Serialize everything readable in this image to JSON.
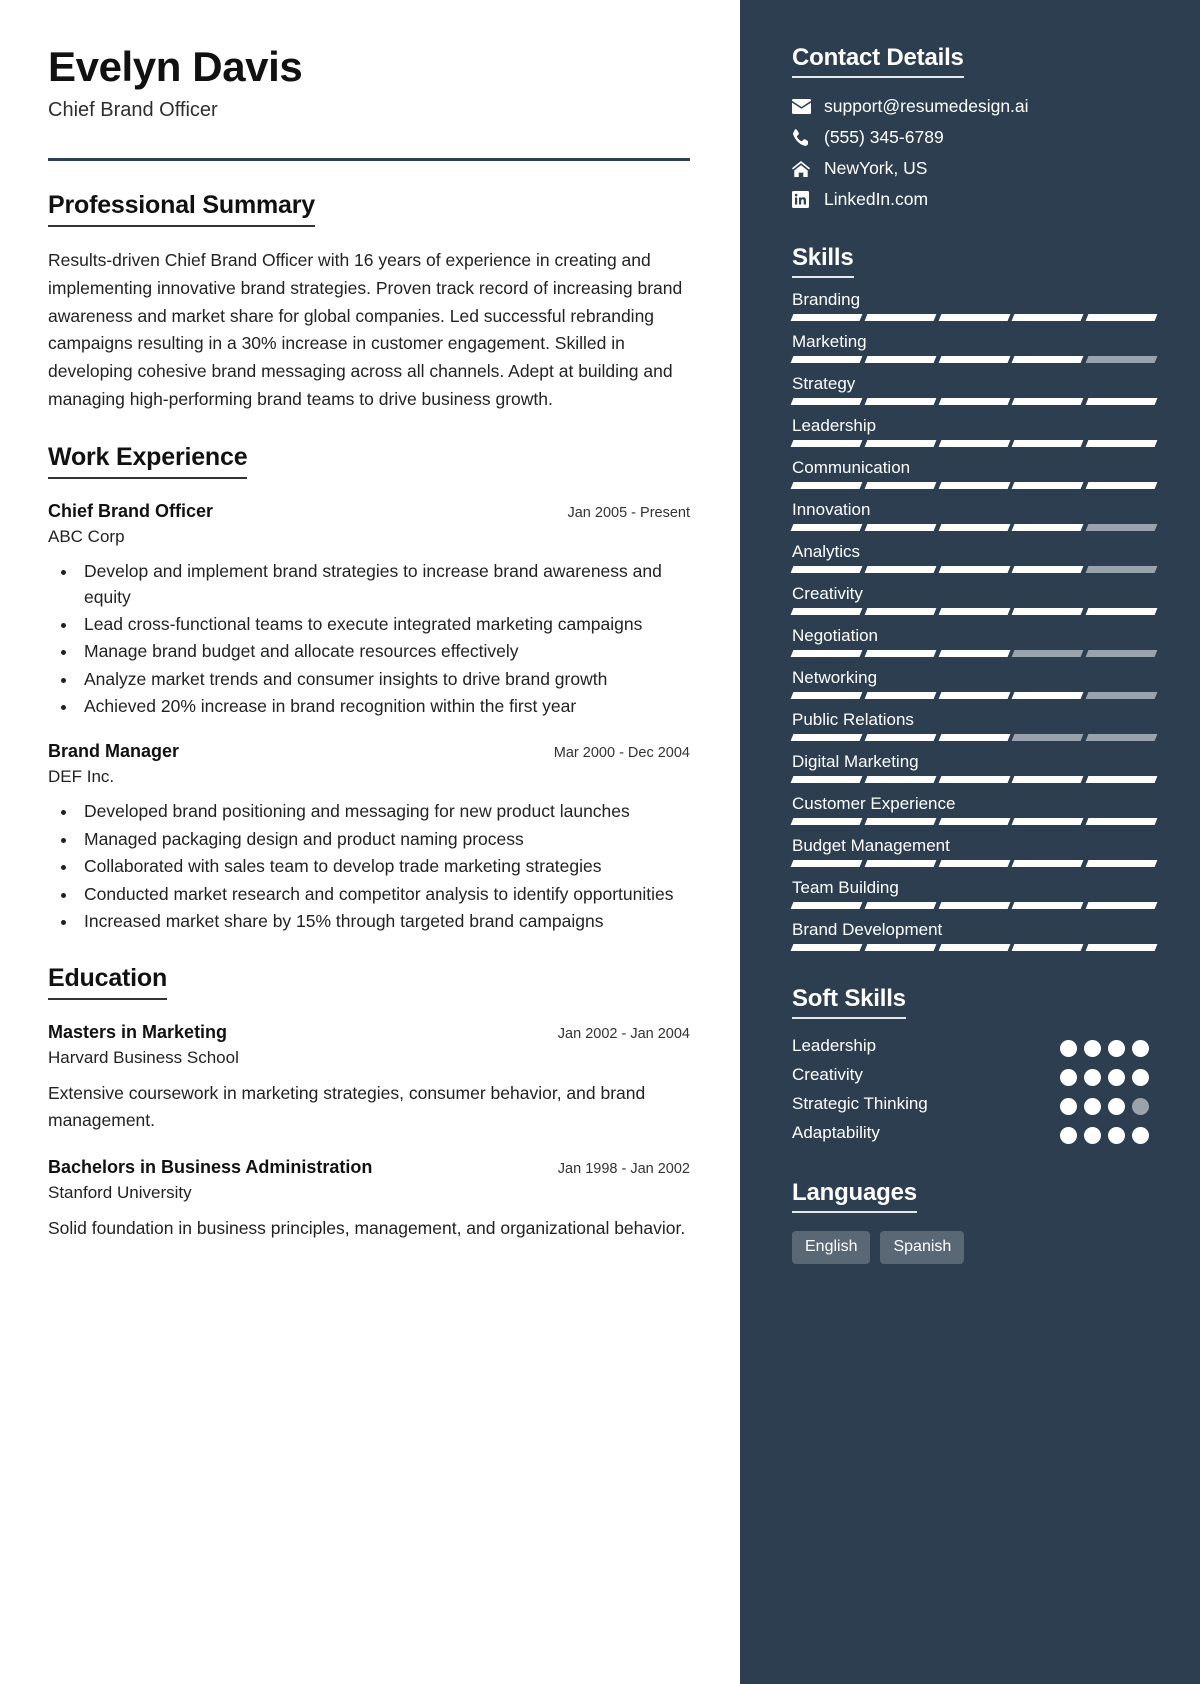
{
  "theme": {
    "sidebar_bg": "#2c3e50",
    "page_bg": "#ffffff",
    "accent_rule": "#2d3e50",
    "skill_on": "#ffffff",
    "skill_off": "#9aa3ab",
    "chip_bg": "#5a6875"
  },
  "header": {
    "name": "Evelyn Davis",
    "job_title": "Chief Brand Officer"
  },
  "summary": {
    "heading": "Professional Summary",
    "text": "Results-driven Chief Brand Officer with 16 years of experience in creating and implementing innovative brand strategies. Proven track record of increasing brand awareness and market share for global companies. Led successful rebranding campaigns resulting in a 30% increase in customer engagement. Skilled in developing cohesive brand messaging across all channels. Adept at building and managing high-performing brand teams to drive business growth."
  },
  "work": {
    "heading": "Work Experience",
    "entries": [
      {
        "role": "Chief Brand Officer",
        "org": "ABC Corp",
        "date": "Jan 2005 - Present",
        "bullets": [
          "Develop and implement brand strategies to increase brand awareness and equity",
          "Lead cross-functional teams to execute integrated marketing campaigns",
          "Manage brand budget and allocate resources effectively",
          "Analyze market trends and consumer insights to drive brand growth",
          "Achieved 20% increase in brand recognition within the first year"
        ]
      },
      {
        "role": "Brand Manager",
        "org": "DEF Inc.",
        "date": "Mar 2000 - Dec 2004",
        "bullets": [
          "Developed brand positioning and messaging for new product launches",
          "Managed packaging design and product naming process",
          "Collaborated with sales team to develop trade marketing strategies",
          "Conducted market research and competitor analysis to identify opportunities",
          "Increased market share by 15% through targeted brand campaigns"
        ]
      }
    ]
  },
  "education": {
    "heading": "Education",
    "entries": [
      {
        "degree": "Masters in Marketing",
        "school": "Harvard Business School",
        "date": "Jan 2002 - Jan 2004",
        "desc": "Extensive coursework in marketing strategies, consumer behavior, and brand management."
      },
      {
        "degree": "Bachelors in Business Administration",
        "school": "Stanford University",
        "date": "Jan 1998 - Jan 2002",
        "desc": "Solid foundation in business principles, management, and organizational behavior."
      }
    ]
  },
  "contact": {
    "heading": "Contact Details",
    "items": [
      {
        "icon": "envelope-icon",
        "value": "support@resumedesign.ai"
      },
      {
        "icon": "phone-icon",
        "value": "(555) 345-6789"
      },
      {
        "icon": "home-icon",
        "value": "NewYork, US"
      },
      {
        "icon": "linkedin-icon",
        "value": "LinkedIn.com"
      }
    ]
  },
  "skills": {
    "heading": "Skills",
    "segments_total": 5,
    "items": [
      {
        "name": "Branding",
        "filled": 5
      },
      {
        "name": "Marketing",
        "filled": 4
      },
      {
        "name": "Strategy",
        "filled": 5
      },
      {
        "name": "Leadership",
        "filled": 5
      },
      {
        "name": "Communication",
        "filled": 5
      },
      {
        "name": "Innovation",
        "filled": 4
      },
      {
        "name": "Analytics",
        "filled": 4
      },
      {
        "name": "Creativity",
        "filled": 5
      },
      {
        "name": "Negotiation",
        "filled": 3
      },
      {
        "name": "Networking",
        "filled": 4
      },
      {
        "name": "Public Relations",
        "filled": 3
      },
      {
        "name": "Digital Marketing",
        "filled": 5
      },
      {
        "name": "Customer Experience",
        "filled": 5
      },
      {
        "name": "Budget Management",
        "filled": 5
      },
      {
        "name": "Team Building",
        "filled": 5
      },
      {
        "name": "Brand Development",
        "filled": 5
      }
    ]
  },
  "soft_skills": {
    "heading": "Soft Skills",
    "dots_total": 4,
    "items": [
      {
        "name": "Leadership",
        "filled": 4
      },
      {
        "name": "Creativity",
        "filled": 4
      },
      {
        "name": "Strategic Thinking",
        "filled": 3
      },
      {
        "name": "Adaptability",
        "filled": 4
      }
    ]
  },
  "languages": {
    "heading": "Languages",
    "items": [
      "English",
      "Spanish"
    ]
  }
}
